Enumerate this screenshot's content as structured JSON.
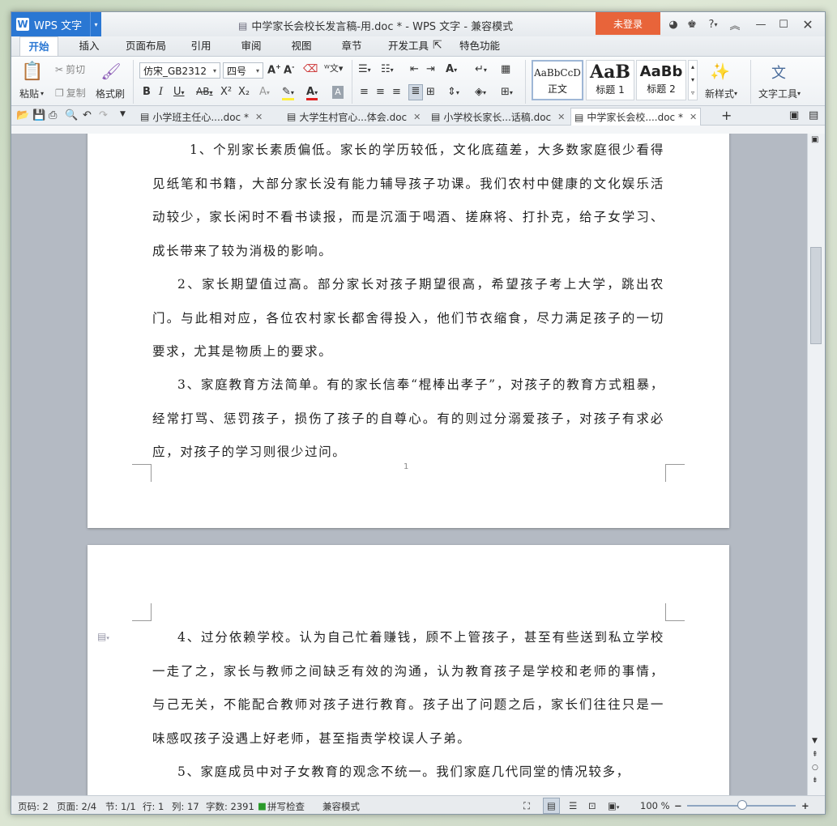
{
  "app": {
    "name": "WPS 文字",
    "logo": "W",
    "window_title": "中学家长会校长发言稿-用.doc * - WPS 文字 - 兼容模式",
    "login": "未登录"
  },
  "menu": {
    "tabs": [
      "开始",
      "插入",
      "页面布局",
      "引用",
      "审阅",
      "视图",
      "章节",
      "开发工具",
      "特色功能"
    ]
  },
  "ribbon": {
    "paste": "粘贴",
    "cut": "剪切",
    "copy": "复制",
    "format_painter": "格式刷",
    "font_name": "仿宋_GB2312",
    "font_size": "四号",
    "styles": [
      {
        "preview": "AaBbCcD",
        "label": "正文"
      },
      {
        "preview": "AaB",
        "label": "标题 1"
      },
      {
        "preview": "AaBb",
        "label": "标题 2"
      }
    ],
    "new_style": "新样式",
    "text_tools": "文字工具"
  },
  "doc_tabs": [
    "小学班主任心....doc *",
    "大学生村官心...体会.doc",
    "小学校长家长...话稿.doc",
    "中学家长会校....doc *"
  ],
  "document": {
    "page1": [
      "1、个别家长素质偏低。家长的学历较低，文化底蕴差，大多数家庭很少看得见纸笔和书籍，大部分家长没有能力辅导孩子功课。我们农村中健康的文化娱乐活动较少，家长闲时不看书读报，而是沉湎于喝酒、搓麻将、打扑克，给子女学习、成长带来了较为消极的影响。",
      "2、家长期望值过高。部分家长对孩子期望很高，希望孩子考上大学，跳出农门。与此相对应，各位农村家长都舍得投入，他们节衣缩食，尽力满足孩子的一切要求，尤其是物质上的要求。",
      "3、家庭教育方法简单。有的家长信奉“棍棒出孝子”，对孩子的教育方式粗暴，经常打骂、惩罚孩子，损伤了孩子的自尊心。有的则过分溺爱孩子，对孩子有求必应，对孩子的学习则很少过问。"
    ],
    "page_number": "1",
    "page2": [
      "4、过分依赖学校。认为自己忙着赚钱，顾不上管孩子，甚至有些送到私立学校一走了之，家长与教师之间缺乏有效的沟通，认为教育孩子是学校和老师的事情，与己无关，不能配合教师对孩子进行教育。孩子出了问题之后，家长们往往只是一味感叹孩子没遇上好老师，甚至指责学校误人子弟。",
      "5、家庭成员中对子女教育的观念不统一。我们家庭几代同堂的情况较多，"
    ]
  },
  "status": {
    "page_no": "页码: 2",
    "pages": "页面: 2/4",
    "section": "节: 1/1",
    "line": "行: 1",
    "col": "列: 17",
    "word_count": "字数: 2391",
    "spell_check": "拼写检查",
    "compat": "兼容模式",
    "zoom": "100 %"
  },
  "colors": {
    "accent": "#2a77d3",
    "login": "#e8643a"
  }
}
